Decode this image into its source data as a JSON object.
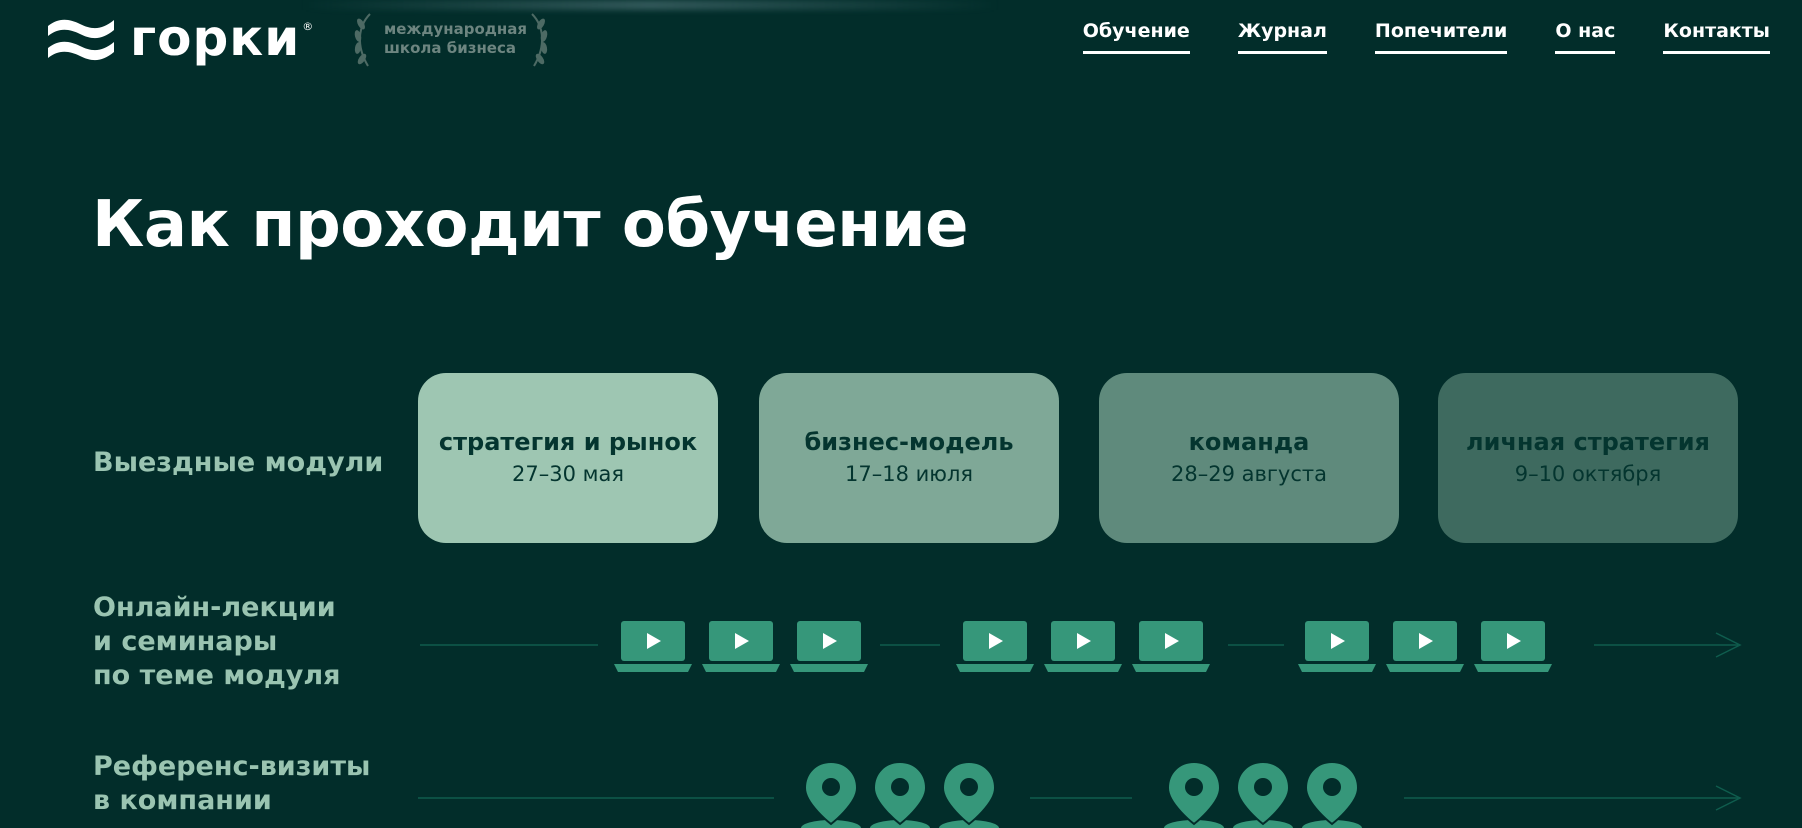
{
  "header": {
    "logo_text": "горки",
    "logo_reg": "®",
    "school_line1": "международная",
    "school_line2": "школа бизнеса",
    "nav": [
      "Обучение",
      "Журнал",
      "Попечители",
      "О нас",
      "Контакты"
    ]
  },
  "main": {
    "title": "Как проходит обучение",
    "rows": {
      "modules_label": "Выездные модули",
      "online_label_1": "Онлайн-лекции",
      "online_label_2": "и семинары",
      "online_label_3": "по теме модуля",
      "visits_label_1": "Референс-визиты",
      "visits_label_2": "в компании"
    },
    "modules": [
      {
        "title": "стратегия и рынок",
        "date": "27–30 мая"
      },
      {
        "title": "бизнес-модель",
        "date": "17–18 июля"
      },
      {
        "title": "команда",
        "date": "28–29 августа"
      },
      {
        "title": "личная стратегия",
        "date": "9–10 октября"
      }
    ]
  },
  "colors": {
    "background": "#022d2a",
    "accent_green": "#36977a",
    "label_green": "#9ac4b1",
    "line": "#0f5c4d"
  },
  "icons": {
    "video": "laptop-play-icon",
    "visit": "map-pin-icon",
    "timeline_end": "arrow-right-icon"
  }
}
